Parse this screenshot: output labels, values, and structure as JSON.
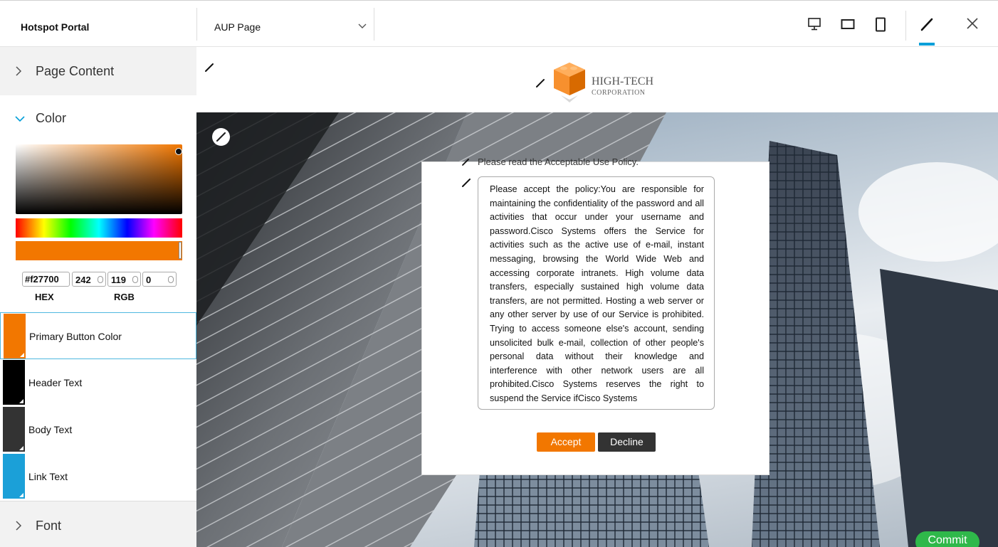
{
  "header": {
    "portal_title": "Hotspot Portal",
    "page_select": {
      "value": "AUP Page"
    }
  },
  "sidebar": {
    "page_content_label": "Page Content",
    "color_label": "Color",
    "picker": {
      "hex": "#f27700",
      "r": "242",
      "g": "119",
      "b": "0",
      "hex_label": "HEX",
      "rgb_label": "RGB"
    },
    "swatches": [
      {
        "label": "Primary Button Color",
        "color": "#f27700"
      },
      {
        "label": "Header Text",
        "color": "#000000"
      },
      {
        "label": "Body Text",
        "color": "#333333"
      },
      {
        "label": "Link Text",
        "color": "#1ba0d8"
      }
    ],
    "font_label": "Font"
  },
  "preview": {
    "logo": {
      "line1": "HIGH-TECH",
      "line2": "CORPORATION"
    },
    "intro": "Please read the Acceptable Use Policy.",
    "policy_text": "Please accept the policy:You are responsible for maintaining the confidentiality of the password and all activities that occur under your username and password.Cisco Systems offers the Service for activities such as the active use of e-mail, instant messaging, browsing the World Wide Web and accessing corporate intranets. High volume data transfers, especially sustained high volume data transfers, are not permitted. Hosting a web server or any other server by use of our Service is prohibited. Trying to access someone else's account, sending unsolicited bulk e-mail, collection of other people's personal data without their knowledge and interference with other network users are all prohibited.Cisco Systems reserves the right to suspend the Service ifCisco Systems",
    "accept_label": "Accept",
    "decline_label": "Decline"
  },
  "commit_label": "Commit",
  "colors": {
    "accent": "#f27700",
    "active_tab": "#049fd9",
    "commit": "#2fb84a"
  }
}
